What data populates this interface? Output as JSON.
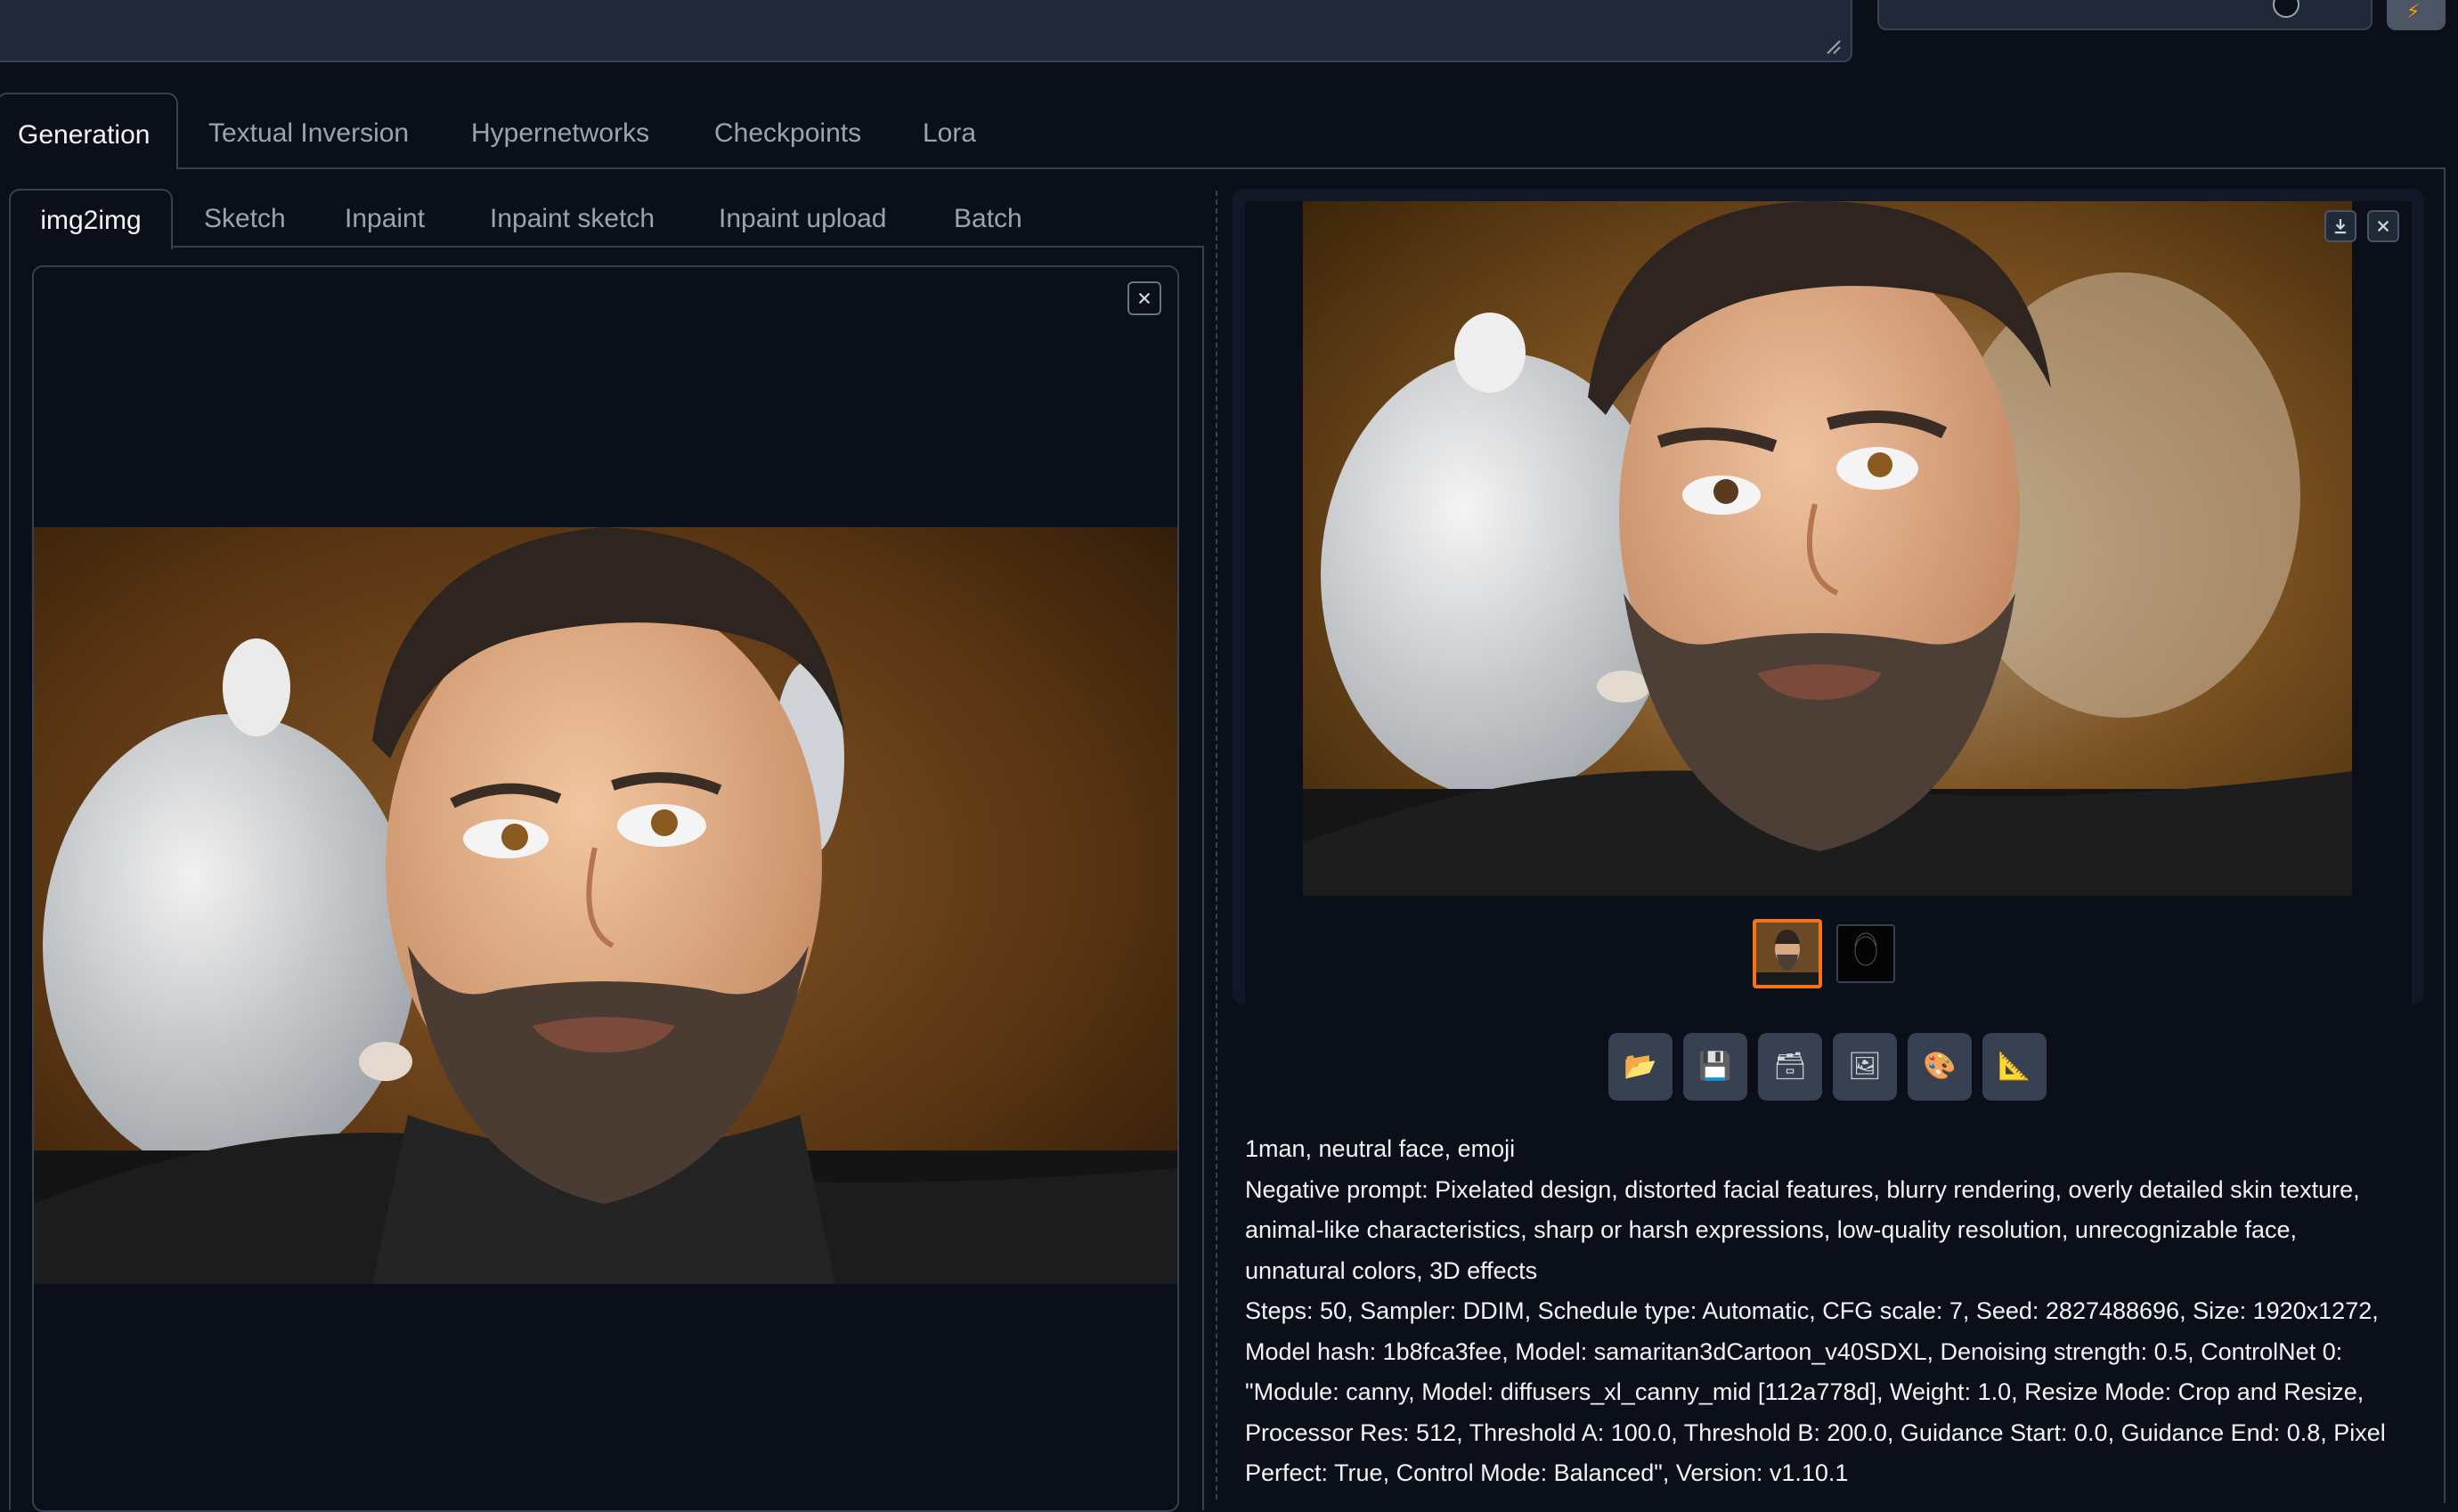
{
  "top": {
    "prompt_resize_icon": "resize-grip-icon",
    "style_clear_icon": "clear-x-icon",
    "extra_icon": "lightning-icon"
  },
  "main_tabs": [
    {
      "label": "Generation",
      "active": true
    },
    {
      "label": "Textual Inversion",
      "active": false
    },
    {
      "label": "Hypernetworks",
      "active": false
    },
    {
      "label": "Checkpoints",
      "active": false
    },
    {
      "label": "Lora",
      "active": false
    }
  ],
  "sub_tabs": [
    {
      "label": "img2img",
      "active": true
    },
    {
      "label": "Sketch",
      "active": false
    },
    {
      "label": "Inpaint",
      "active": false
    },
    {
      "label": "Inpaint sketch",
      "active": false
    },
    {
      "label": "Inpaint upload",
      "active": false
    },
    {
      "label": "Batch",
      "active": false
    }
  ],
  "input_image": {
    "close_icon": "close-icon",
    "content": "bearded-man-portrait"
  },
  "gallery": {
    "download_icon": "download-icon",
    "close_icon": "close-icon",
    "thumbnails": [
      {
        "content": "bearded-man-portrait",
        "selected": true
      },
      {
        "content": "canny-edge-map",
        "selected": false
      }
    ]
  },
  "toolbar": [
    {
      "name": "open-folder-button",
      "icon": "folder-icon",
      "glyph": "📂"
    },
    {
      "name": "save-button",
      "icon": "floppy-disk-icon",
      "glyph": "💾"
    },
    {
      "name": "zip-button",
      "icon": "archive-box-icon",
      "glyph": "🗃"
    },
    {
      "name": "send-to-img2img-button",
      "icon": "picture-icon",
      "glyph": "🖼"
    },
    {
      "name": "send-to-inpaint-button",
      "icon": "palette-icon",
      "glyph": "🎨"
    },
    {
      "name": "send-to-extras-button",
      "icon": "triangle-ruler-icon",
      "glyph": "📐"
    }
  ],
  "generation_info": {
    "prompt": "1man, neutral face, emoji",
    "negative_prompt": "Negative prompt: Pixelated design, distorted facial features, blurry rendering, overly detailed skin texture, animal-like characteristics, sharp or harsh expressions, low-quality resolution, unrecognizable face, unnatural colors, 3D effects",
    "parameters": "Steps: 50, Sampler: DDIM, Schedule type: Automatic, CFG scale: 7, Seed: 2827488696, Size: 1920x1272, Model hash: 1b8fca3fee, Model: samaritan3dCartoon_v40SDXL, Denoising strength: 0.5, ControlNet 0: \"Module: canny, Model: diffusers_xl_canny_mid [112a778d], Weight: 1.0, Resize Mode: Crop and Resize, Processor Res: 512, Threshold A: 100.0, Threshold B: 200.0, Guidance Start: 0.0, Guidance End: 0.8, Pixel Perfect: True, Control Mode: Balanced\", Version: v1.10.1"
  },
  "colors": {
    "background": "#0b0f19",
    "panel": "#1f2937",
    "border": "#374151",
    "accent": "#f97316"
  }
}
